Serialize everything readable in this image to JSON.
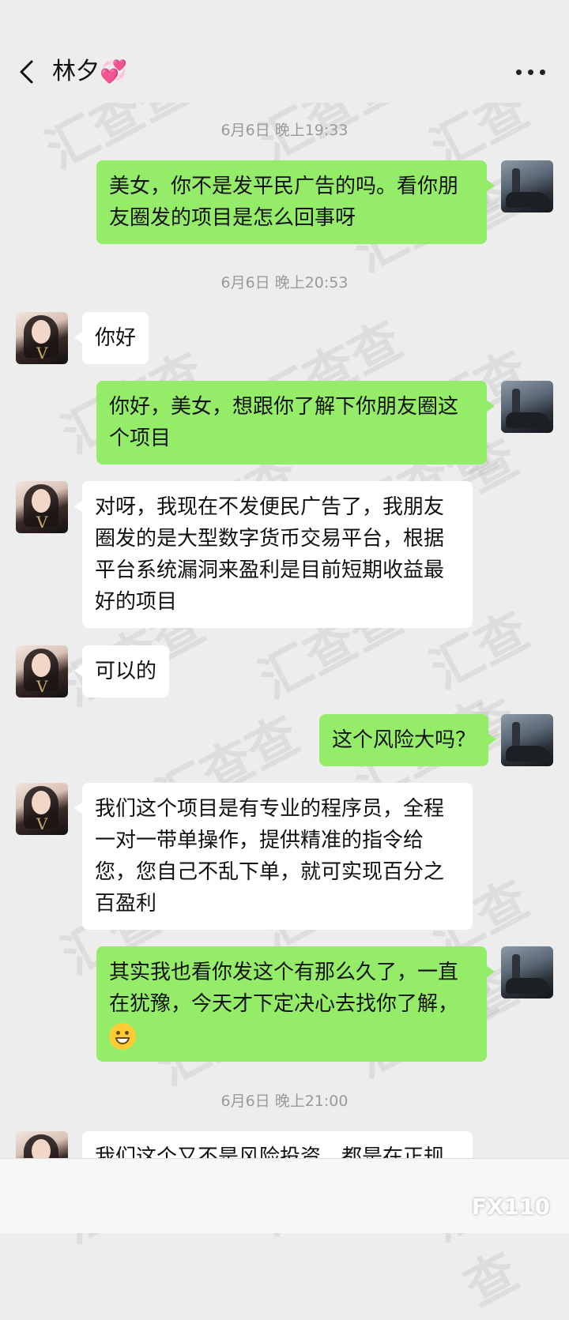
{
  "header": {
    "title": "林夕",
    "title_emoji": "💞"
  },
  "timestamps": [
    "6月6日 晚上19:33",
    "6月6日 晚上20:53",
    "6月6日 晚上21:00"
  ],
  "messages": [
    {
      "sender": "me",
      "text": "美女，你不是发平民广告的吗。看你朋友圈发的项目是怎么回事呀"
    },
    {
      "sender": "her",
      "text": "你好"
    },
    {
      "sender": "me",
      "text": "你好，美女，想跟你了解下你朋友圈这个项目"
    },
    {
      "sender": "her",
      "text": "对呀，我现在不发便民广告了，我朋友圈发的是大型数字货币交易平台，根据平台系统漏洞来盈利是目前短期收益最好的项目"
    },
    {
      "sender": "her",
      "text": "可以的"
    },
    {
      "sender": "me",
      "text": "这个风险大吗？"
    },
    {
      "sender": "her",
      "text": "我们这个项目是有专业的程序员，全程一对一带单操作，提供精准的指令给您，您自己不乱下单，就可实现百分之百盈利"
    },
    {
      "sender": "me",
      "text": "其实我也看你发这个有那么久了，一直在犹豫，今天才下定决心去找你了解，"
    },
    {
      "sender": "her",
      "text": "我们这个又不是风险投资，都是在正规"
    }
  ],
  "watermark": "汇查查",
  "brand": "FX110",
  "colors": {
    "background": "#ededed",
    "me_bubble": "#95ec69",
    "her_bubble": "#ffffff",
    "timestamp": "#9a9a9a"
  },
  "icons": [
    "chevron-left-icon",
    "more-dots-icon",
    "grin-emoji-icon"
  ]
}
